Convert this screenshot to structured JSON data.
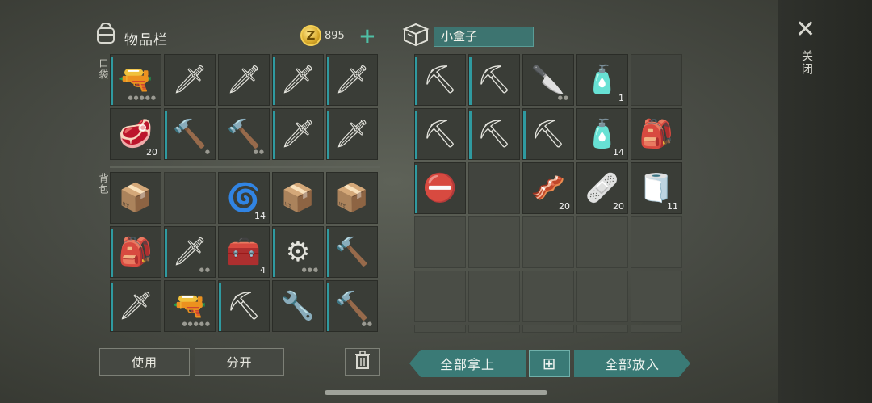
{
  "inventory": {
    "title": "物品栏",
    "coins": "895",
    "coin_symbol": "Z",
    "add_symbol": "+",
    "pockets_label": "口袋",
    "backpack_label": "背包",
    "pockets": [
      {
        "icon": "🔫",
        "name": "rifle",
        "dots": "●●●●●",
        "bar": true
      },
      {
        "icon": "🗡",
        "name": "machete",
        "bar": false
      },
      {
        "icon": "🗡",
        "name": "machete",
        "bar": false
      },
      {
        "icon": "🗡",
        "name": "machete",
        "bar": true
      },
      {
        "icon": "🗡",
        "name": "machete",
        "bar": true
      },
      {
        "icon": "🥩",
        "name": "raw-meat",
        "qty": "20",
        "bar": false
      },
      {
        "icon": "🔨",
        "name": "crowbar",
        "dots": "●",
        "bar": true
      },
      {
        "icon": "🔨",
        "name": "crowbar",
        "dots": "●●",
        "bar": false
      },
      {
        "icon": "🗡",
        "name": "machete",
        "bar": true
      },
      {
        "icon": "🗡",
        "name": "machete",
        "bar": true
      }
    ],
    "backpack": [
      {
        "icon": "📦",
        "name": "supply-crate",
        "bar": false
      },
      {
        "icon": "",
        "name": "empty",
        "bar": false
      },
      {
        "icon": "🌀",
        "name": "spring",
        "qty": "14",
        "bar": false
      },
      {
        "icon": "📦",
        "name": "supply-crate",
        "bar": false
      },
      {
        "icon": "📦",
        "name": "supply-crate",
        "bar": false
      },
      {
        "icon": "🎒",
        "name": "military-backpack",
        "bar": true
      },
      {
        "icon": "🗡",
        "name": "machete",
        "dots": "●●",
        "bar": true
      },
      {
        "icon": "🧰",
        "name": "medkit-bag",
        "qty": "4",
        "bar": false
      },
      {
        "icon": "⚙",
        "name": "spiked-club",
        "dots": "●●●",
        "bar": true
      },
      {
        "icon": "🔨",
        "name": "sledgehammer",
        "bar": true
      },
      {
        "icon": "🗡",
        "name": "machete",
        "bar": true
      },
      {
        "icon": "🔫",
        "name": "pistol",
        "dots": "●●●●●",
        "bar": false
      },
      {
        "icon": "⛏",
        "name": "hammer",
        "bar": true
      },
      {
        "icon": "🔧",
        "name": "shovel",
        "bar": false
      },
      {
        "icon": "🔨",
        "name": "crowbar",
        "dots": "●●",
        "bar": true
      }
    ],
    "use_label": "使用",
    "split_label": "分开"
  },
  "container": {
    "name": "小盒子",
    "slots": [
      {
        "icon": "⛏",
        "name": "hammer",
        "bar": true
      },
      {
        "icon": "⛏",
        "name": "hammer",
        "bar": true
      },
      {
        "icon": "🔪",
        "name": "cleaver",
        "dots": "●●",
        "bar": false
      },
      {
        "icon": "🧴",
        "name": "water-bottle",
        "qty": "1",
        "bar": false
      },
      {
        "icon": "",
        "name": "empty",
        "bar": false
      },
      {
        "icon": "⛏",
        "name": "pickaxe",
        "bar": true
      },
      {
        "icon": "⛏",
        "name": "pickaxe",
        "bar": true
      },
      {
        "icon": "⛏",
        "name": "hammer",
        "bar": true
      },
      {
        "icon": "🧴",
        "name": "water-bottle",
        "qty": "14",
        "bar": false
      },
      {
        "icon": "🎒",
        "name": "backpack",
        "bar": false
      },
      {
        "icon": "⛔",
        "name": "stop-sign",
        "bar": true
      },
      {
        "icon": "",
        "name": "empty",
        "bar": false
      },
      {
        "icon": "🥓",
        "name": "raw-meat-strips",
        "qty": "20",
        "bar": false
      },
      {
        "icon": "🩹",
        "name": "bandage",
        "qty": "20",
        "bar": false
      },
      {
        "icon": "🧻",
        "name": "cloth",
        "qty": "11",
        "bar": false
      }
    ],
    "take_all_label": "全部拿上",
    "grid_icon": "⊞",
    "put_all_label": "全部放入"
  },
  "close": {
    "symbol": "✕",
    "label": "关闭"
  },
  "colors": {
    "accent": "#3a7a76",
    "durability": "#2f9aa0",
    "coin": "#d7a829"
  }
}
